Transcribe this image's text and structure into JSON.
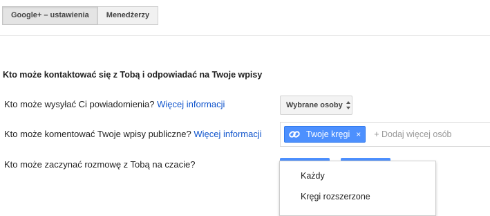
{
  "tabs": [
    {
      "label": "Google+ – ustawienia",
      "active": true
    },
    {
      "label": "Menedżerzy",
      "active": false
    }
  ],
  "section": {
    "heading": "Kto może kontaktować się z Tobą i odpowiadać na Twoje wpisy"
  },
  "settings": [
    {
      "label": "Kto może wysyłać Ci powiadomienia?",
      "link": "Więcej informacji"
    },
    {
      "label": "Kto może komentować Twoje wpisy publiczne?",
      "link": "Więcej informacji"
    },
    {
      "label": "Kto może zaczynać rozmowę z Tobą na czacie?",
      "link": ""
    }
  ],
  "notifications_select": {
    "value": "Wybrane osoby",
    "icon": "up-down-arrows-icon"
  },
  "comments_share_box": {
    "chip_label": "Twoje kręgi",
    "chip_icon": "link-icon",
    "chip_remove": "×",
    "placeholder": "+ Dodaj więcej osób"
  },
  "chat_dropdown": {
    "items": [
      "Każdy",
      "Kręgi rozszerzone"
    ]
  },
  "colors": {
    "link": "#1155cc",
    "chip": "#4d90fe",
    "text": "#222222"
  }
}
